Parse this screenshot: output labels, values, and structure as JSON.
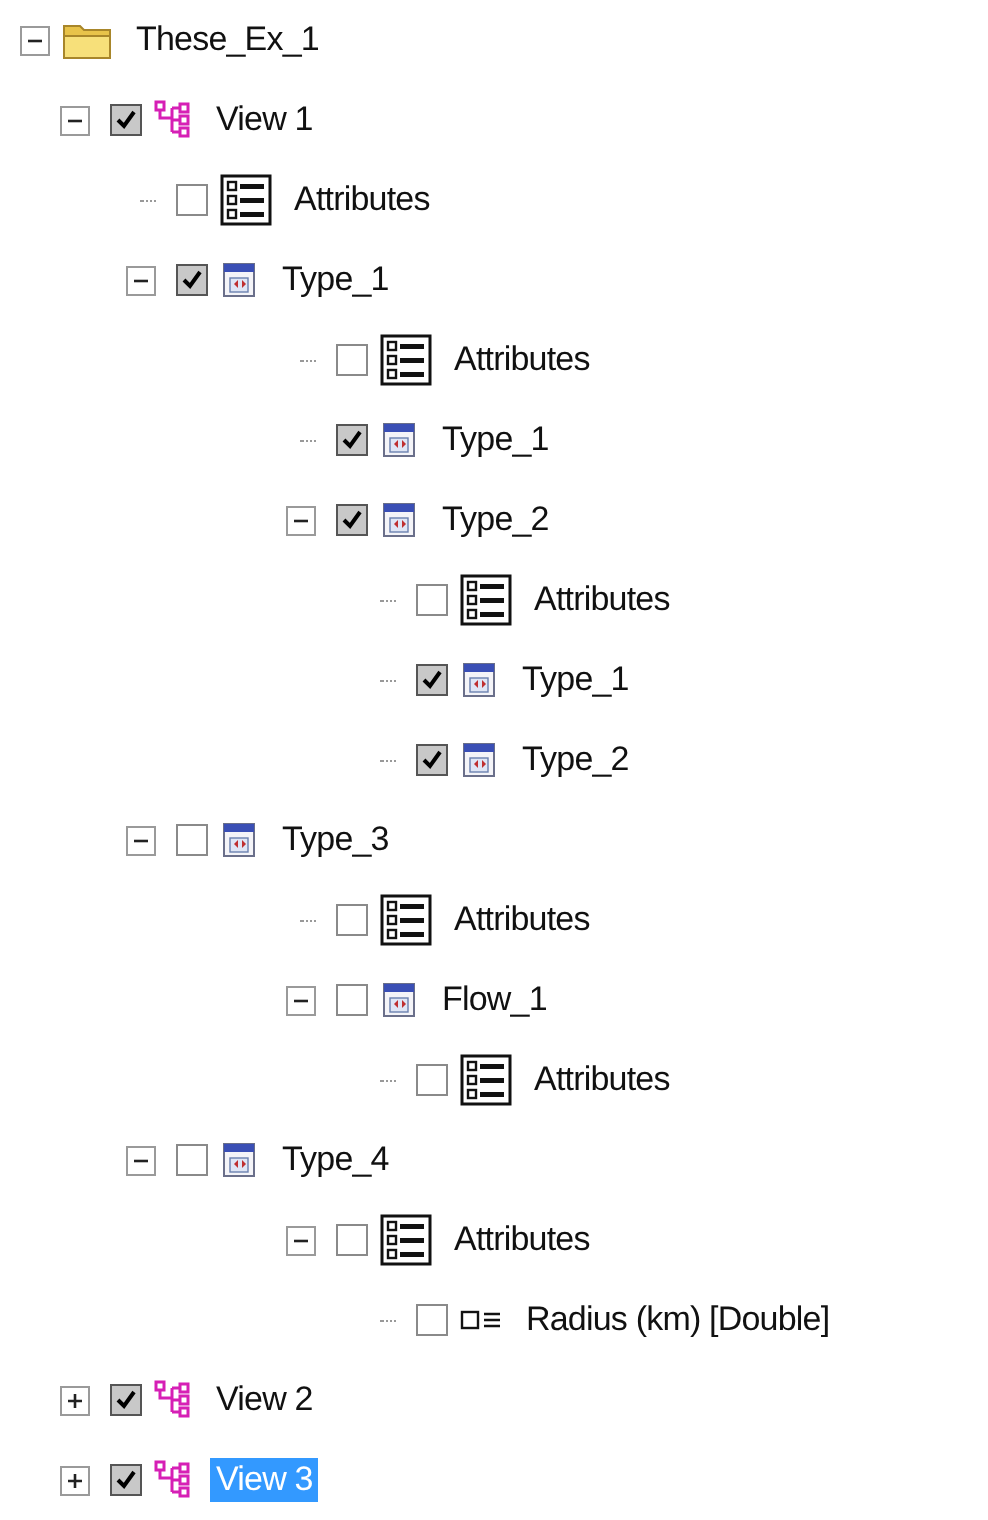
{
  "tree": [
    {
      "label": "These_Ex_1",
      "kind": "folder",
      "expanded": true,
      "selected": false,
      "children": [
        {
          "label": "View 1",
          "kind": "view",
          "checked": true,
          "expanded": true,
          "selected": false,
          "children": [
            {
              "label": "Attributes",
              "kind": "attributes",
              "checked": false,
              "selected": false
            },
            {
              "label": "Type_1",
              "kind": "type",
              "checked": true,
              "expanded": true,
              "selected": false,
              "children": [
                {
                  "label": "Attributes",
                  "kind": "attributes",
                  "checked": false,
                  "selected": false
                },
                {
                  "label": "Type_1",
                  "kind": "type",
                  "checked": true,
                  "selected": false
                },
                {
                  "label": "Type_2",
                  "kind": "type",
                  "checked": true,
                  "expanded": true,
                  "selected": false,
                  "children": [
                    {
                      "label": "Attributes",
                      "kind": "attributes",
                      "checked": false,
                      "selected": false
                    },
                    {
                      "label": "Type_1",
                      "kind": "type",
                      "checked": true,
                      "selected": false
                    },
                    {
                      "label": "Type_2",
                      "kind": "type",
                      "checked": true,
                      "selected": false
                    }
                  ]
                }
              ]
            },
            {
              "label": "Type_3",
              "kind": "type",
              "checked": false,
              "expanded": true,
              "selected": false,
              "children": [
                {
                  "label": "Attributes",
                  "kind": "attributes",
                  "checked": false,
                  "selected": false
                },
                {
                  "label": "Flow_1",
                  "kind": "type",
                  "checked": false,
                  "expanded": true,
                  "selected": false,
                  "children": [
                    {
                      "label": "Attributes",
                      "kind": "attributes",
                      "checked": false,
                      "selected": false
                    }
                  ]
                }
              ]
            },
            {
              "label": "Type_4",
              "kind": "type",
              "checked": false,
              "expanded": true,
              "selected": false,
              "children": [
                {
                  "label": "Attributes",
                  "kind": "attributes",
                  "checked": false,
                  "expanded": true,
                  "selected": false,
                  "children": [
                    {
                      "label": "Radius (km) [Double]",
                      "kind": "field",
                      "checked": false,
                      "selected": false
                    }
                  ]
                }
              ]
            }
          ]
        },
        {
          "label": "View 2",
          "kind": "view",
          "checked": true,
          "expanded": false,
          "selected": false
        },
        {
          "label": "View 3",
          "kind": "view",
          "checked": true,
          "expanded": false,
          "selected": true
        }
      ]
    }
  ]
}
